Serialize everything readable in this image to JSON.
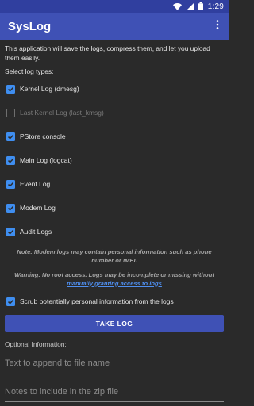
{
  "status_bar": {
    "time": "1:29",
    "icons": [
      "wifi-icon",
      "signal-icon",
      "battery-icon"
    ]
  },
  "app_bar": {
    "title": "SysLog",
    "menu_icon": "more-vert-icon"
  },
  "content": {
    "intro": "This application will save the logs, compress them, and let you upload them easily.",
    "select_label": "Select log types:",
    "log_types": [
      {
        "label": "Kernel Log (dmesg)",
        "checked": true,
        "enabled": true
      },
      {
        "label": "Last Kernel Log (last_kmsg)",
        "checked": false,
        "enabled": false
      },
      {
        "label": "PStore console",
        "checked": true,
        "enabled": true
      },
      {
        "label": "Main Log (logcat)",
        "checked": true,
        "enabled": true
      },
      {
        "label": "Event Log",
        "checked": true,
        "enabled": true
      },
      {
        "label": "Modem Log",
        "checked": true,
        "enabled": true
      },
      {
        "label": "Audit Logs",
        "checked": true,
        "enabled": true
      }
    ],
    "note_modem": "Note: Modem logs may contain personal information such as phone number or IMEI.",
    "note_root_prefix": "Warning: No root access. Logs may be incomplete or missing without ",
    "note_root_link": "manually granting access to logs",
    "scrub_label": "Scrub potentially personal information from the logs",
    "scrub_checked": true,
    "take_log_label": "TAKE LOG",
    "optional_label": "Optional Information:",
    "file_name_placeholder": "Text to append to file name",
    "notes_placeholder": "Notes to include in the zip file"
  },
  "colors": {
    "status_bar": "#303f9f",
    "app_bar": "#3f51b5",
    "accent": "#3f8ef0",
    "background": "#2a2a2a"
  }
}
